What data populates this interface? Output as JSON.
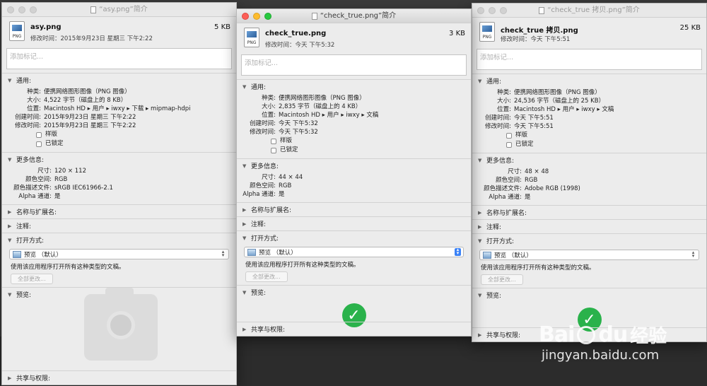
{
  "windows": [
    {
      "title": "“asy.png”简介",
      "name": "asy.png",
      "size": "5 KB",
      "modified_line": "修改时间：2015年9月23日 星期三 下午2:22",
      "tag_placeholder": "添加标记...",
      "general_header": "通用:",
      "general": [
        {
          "k": "种类:",
          "v": "便携网络图形图像（PNG 图像）"
        },
        {
          "k": "大小:",
          "v": "4,522 字节（磁盘上的 8 KB）"
        },
        {
          "k": "位置:",
          "v": "Macintosh HD ▸ 用户 ▸ iwxy ▸ 下载 ▸ mipmap-hdpi"
        },
        {
          "k": "创建时间:",
          "v": "2015年9月23日 星期三 下午2:22"
        },
        {
          "k": "修改时间:",
          "v": "2015年9月23日 星期三 下午2:22"
        }
      ],
      "stationery": "样版",
      "locked": "已锁定",
      "more_header": "更多信息:",
      "more": [
        {
          "k": "尺寸:",
          "v": "120 × 112"
        },
        {
          "k": "颜色空间:",
          "v": "RGB"
        },
        {
          "k": "颜色描述文件:",
          "v": "sRGB IEC61966-2.1"
        },
        {
          "k": "Alpha 通道:",
          "v": "是"
        }
      ],
      "name_ext_header": "名称与扩展名:",
      "comments_header": "注释:",
      "open_with_header": "打开方式:",
      "open_with_app": "预览 （默认）",
      "open_with_desc": "使用该应用程序打开所有这种类型的文稿。",
      "change_all": "全部更改...",
      "preview_header": "预览:",
      "sharing_header": "共享与权限:"
    },
    {
      "title": "“check_true.png”简介",
      "name": "check_true.png",
      "size": "3 KB",
      "modified_line": "修改时间：今天 下午5:32",
      "tag_placeholder": "添加标记...",
      "general_header": "通用:",
      "general": [
        {
          "k": "种类:",
          "v": "便携网络图形图像（PNG 图像）"
        },
        {
          "k": "大小:",
          "v": "2,835 字节（磁盘上的 4 KB）"
        },
        {
          "k": "位置:",
          "v": "Macintosh HD ▸ 用户 ▸ iwxy ▸ 文稿"
        },
        {
          "k": "创建时间:",
          "v": "今天 下午5:32"
        },
        {
          "k": "修改时间:",
          "v": "今天 下午5:32"
        }
      ],
      "stationery": "样版",
      "locked": "已锁定",
      "more_header": "更多信息:",
      "more": [
        {
          "k": "尺寸:",
          "v": "44 × 44"
        },
        {
          "k": "颜色空间:",
          "v": "RGB"
        },
        {
          "k": "Alpha 通道:",
          "v": "是"
        }
      ],
      "name_ext_header": "名称与扩展名:",
      "comments_header": "注释:",
      "open_with_header": "打开方式:",
      "open_with_app": "预览 （默认）",
      "open_with_desc": "使用该应用程序打开所有这种类型的文稿。",
      "change_all": "全部更改...",
      "preview_header": "预览:",
      "sharing_header": "共享与权限:"
    },
    {
      "title": "“check_true 拷贝.png”简介",
      "name": "check_true 拷贝.png",
      "size": "25 KB",
      "modified_line": "修改时间：今天 下午5:51",
      "tag_placeholder": "添加标记...",
      "general_header": "通用:",
      "general": [
        {
          "k": "种类:",
          "v": "便携网络图形图像（PNG 图像）"
        },
        {
          "k": "大小:",
          "v": "24,536 字节（磁盘上的 25 KB）"
        },
        {
          "k": "位置:",
          "v": "Macintosh HD ▸ 用户 ▸ iwxy ▸ 文稿"
        },
        {
          "k": "创建时间:",
          "v": "今天 下午5:51"
        },
        {
          "k": "修改时间:",
          "v": "今天 下午5:51"
        }
      ],
      "stationery": "样版",
      "locked": "已锁定",
      "more_header": "更多信息:",
      "more": [
        {
          "k": "尺寸:",
          "v": "48 × 48"
        },
        {
          "k": "颜色空间:",
          "v": "RGB"
        },
        {
          "k": "颜色描述文件:",
          "v": "Adobe RGB (1998)"
        },
        {
          "k": "Alpha 通道:",
          "v": "是"
        }
      ],
      "name_ext_header": "名称与扩展名:",
      "comments_header": "注释:",
      "open_with_header": "打开方式:",
      "open_with_app": "预览 （默认）",
      "open_with_desc": "使用该应用程序打开所有这种类型的文稿。",
      "change_all": "全部更改...",
      "preview_header": "预览:",
      "sharing_header": "共享与权限:"
    }
  ],
  "file_icon_ext": "PNG",
  "preview_check_glyph": "✓",
  "watermark": {
    "brand": "Bai",
    "brand2": "du",
    "cn": "经验",
    "url": "jingyan.baidu.com"
  },
  "colors": {
    "accent": "#3b82f6",
    "check_green": "#2ab24b",
    "close": "#fc5f57",
    "minimize": "#fdbc2e",
    "zoom": "#28c840"
  }
}
